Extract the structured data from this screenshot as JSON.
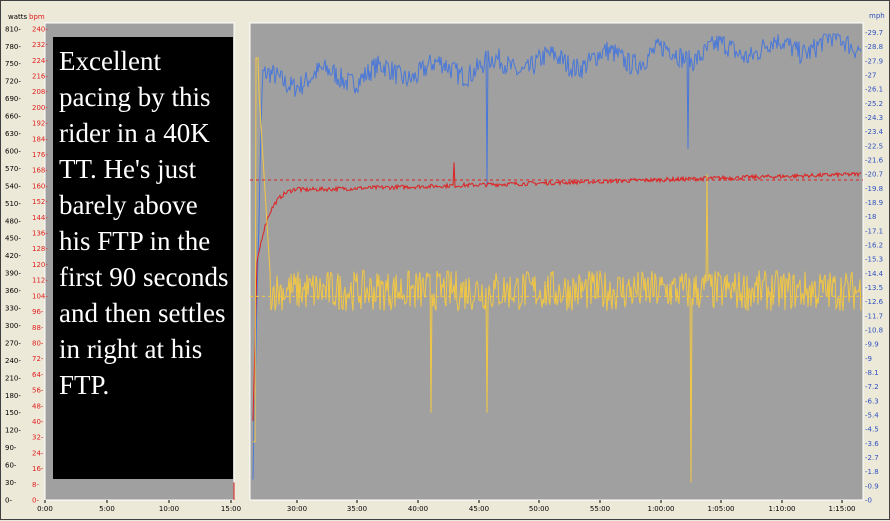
{
  "axis_units": {
    "watts": "watts",
    "bpm": "bpm",
    "mph": "mph"
  },
  "watts_ticks": [
    "0",
    "30",
    "60",
    "90",
    "120",
    "150",
    "180",
    "210",
    "240",
    "270",
    "300",
    "330",
    "360",
    "390",
    "420",
    "450",
    "480",
    "510",
    "540",
    "570",
    "600",
    "630",
    "660",
    "690",
    "720",
    "750",
    "780",
    "810"
  ],
  "bpm_ticks": [
    "0",
    "8",
    "16",
    "24",
    "32",
    "40",
    "48",
    "56",
    "64",
    "72",
    "80",
    "88",
    "96",
    "104",
    "112",
    "120",
    "128",
    "136",
    "144",
    "152",
    "160",
    "168",
    "176",
    "184",
    "192",
    "200",
    "208",
    "216",
    "224",
    "232",
    "240"
  ],
  "mph_ticks": [
    "0",
    "0.9",
    "1.8",
    "2.7",
    "3.6",
    "4.5",
    "5.4",
    "6.3",
    "7.2",
    "8.1",
    "9",
    "9.9",
    "10.8",
    "11.7",
    "12.6",
    "13.5",
    "14.4",
    "15.3",
    "16.2",
    "17.1",
    "18",
    "18.9",
    "19.8",
    "20.7",
    "21.6",
    "22.5",
    "23.4",
    "24.3",
    "25.2",
    "26.1",
    "27",
    "27.9",
    "28.8",
    "29.7"
  ],
  "left_time_ticks": [
    "0:00",
    "5:00",
    "10:00",
    "15:00"
  ],
  "right_time_ticks": [
    "30:00",
    "35:00",
    "40:00",
    "45:00",
    "50:00",
    "55:00",
    "1:00:00",
    "1:05:00",
    "1:10:00",
    "1:15:00"
  ],
  "annotation": "Excellent pacing by this rider in a 40K TT. He's just barely above his FTP in the first 90 seconds and then settles in right at his FTP.",
  "colors": {
    "speed": "#4a78d8",
    "heart_rate": "#e02020",
    "power": "#f2c744",
    "plot_bg": "#a0a0a0",
    "page_bg": "#ece9d8"
  },
  "chart_data": {
    "type": "line",
    "reference_lines": {
      "power_ftp_watts": 350,
      "heart_rate_bpm": 163
    }
  }
}
